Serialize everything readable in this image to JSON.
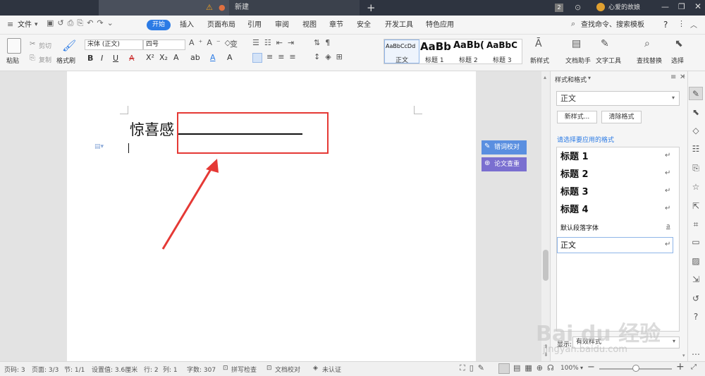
{
  "tabs": {
    "active_title": "",
    "new_tab": "新建",
    "plus": "+",
    "user": "心爱的故娘",
    "badge": "2"
  },
  "menu": {
    "file": "文件",
    "items": [
      "开始",
      "插入",
      "页面布局",
      "引用",
      "审阅",
      "视图",
      "章节",
      "安全",
      "开发工具",
      "特色应用"
    ],
    "search": "查找命令、搜索模板",
    "help": "?"
  },
  "ribbon": {
    "paste": "粘贴",
    "cut": "剪切",
    "copy": "复制",
    "format_painter": "格式刷",
    "font_name": "宋体 (正文)",
    "font_size": "四号",
    "styles": [
      {
        "preview": "AaBbCcDd",
        "label": "正文"
      },
      {
        "preview": "AaBb",
        "label": "标题 1"
      },
      {
        "preview": "AaBb(",
        "label": "标题 2"
      },
      {
        "preview": "AaBbC",
        "label": "标题 3"
      }
    ],
    "new_style": "新样式",
    "doc_helper": "文档助手",
    "text_tools": "文字工具",
    "find_replace": "查找替换",
    "select": "选择"
  },
  "document": {
    "text": "惊喜感",
    "side_btn_1": "错词校对",
    "side_btn_2": "论文查重"
  },
  "panel": {
    "title": "样式和格式",
    "current_style": "正文",
    "new_style_btn": "新样式...",
    "clear_format_btn": "清除格式",
    "apply_label": "请选择要应用的格式",
    "styles": [
      "标题 1",
      "标题 2",
      "标题 3",
      "标题 4"
    ],
    "default_font": "默认段落字体",
    "body": "正文",
    "show_label": "显示:",
    "show_value": "有效样式"
  },
  "status": {
    "page_num": "页码: 3",
    "pages": "页面: 3/3",
    "section": "节: 1/1",
    "setting": "设置值: 3.6厘米",
    "row": "行: 2",
    "col": "列: 1",
    "words": "字数: 307",
    "spell": "拼写检查",
    "doc_check": "文档校对",
    "uncert": "未认证",
    "zoom": "100%",
    "zoom_minus": "−",
    "zoom_plus": "+"
  },
  "watermark": {
    "brand": "Bai du 经验",
    "url": "jingyan.baidu.com"
  },
  "colors": {
    "accent": "#2c7be5",
    "annotation": "#e53935",
    "side_btn": "#4a7cdb"
  }
}
